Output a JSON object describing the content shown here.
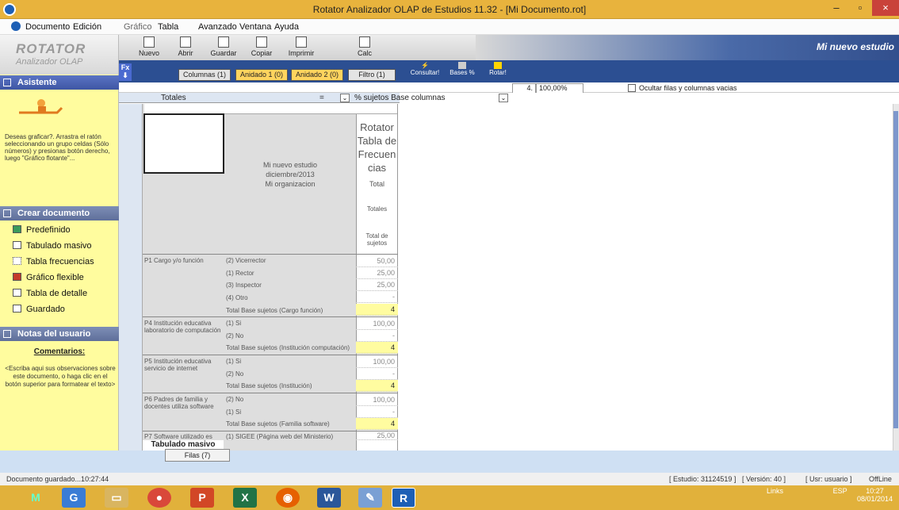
{
  "window": {
    "title": "Rotator Analizador OLAP de Estudios 11.32 - [Mi Documento.rot]",
    "min": "–",
    "max": "▫",
    "close": "×"
  },
  "menu": [
    "Documento",
    "Edición",
    "Gráfico",
    "Tabla",
    "Avanzado",
    "Ventana",
    "Ayuda"
  ],
  "logo": {
    "name": "ROTATOR",
    "sub": "Analizador OLAP"
  },
  "toolbar": [
    "Nuevo",
    "Abrir",
    "Guardar",
    "Copiar",
    "Imprimir",
    "Calc"
  ],
  "brand": "Mi nuevo estudio",
  "dims": {
    "columnas": "Columnas (1)",
    "anidado1": "Anidado 1 (0)",
    "anidado2": "Anidado 2 (0)",
    "filtro": "Filtro (1)"
  },
  "actions": [
    "Consultar!",
    "Bases %",
    "Rotar!"
  ],
  "options": {
    "decimals": "4.",
    "pct": "100,00%",
    "hide_empty": "Ocultar filas y columnas vacias"
  },
  "header": {
    "rows_label": "Totales",
    "eq": "=",
    "cols_label": "% sujetos Base columnas"
  },
  "sidebar": {
    "asistente": "Asistente",
    "help": "Deseas graficar?. Arrastra el ratón seleccionando un grupo celdas (Sólo números) y presionas botón derecho, luego \"Gráfico flotante\"...",
    "crear": "Crear documento",
    "items": [
      "Predefinido",
      "Tabulado masivo",
      "Tabla frecuencias",
      "Gráfico flexible",
      "Tabla de detalle",
      "Guardado"
    ],
    "notas": "Notas del usuario",
    "comentarios": "Comentarios:",
    "note": "<Escriba aqui sus observaciones sobre este documento, o haga clic en el botón superior para formatear el texto>"
  },
  "table": {
    "study": [
      "Mi nuevo estudio",
      "diciembre/2013",
      "Mi organizacion"
    ],
    "title": [
      "Rotator",
      "Tabla de",
      "Frecuen",
      "cias"
    ],
    "col_total": "Total",
    "col_totales": "Totales",
    "col_sujetos": "Total de sujetos",
    "rows": [
      {
        "q": "P1 Cargo y/o función",
        "labels": [
          "(2) Vicerrector",
          "(1) Rector",
          "(3) Inspector",
          "(4) Otro",
          "Total Base sujetos (Cargo función)"
        ],
        "values": [
          "50,00",
          "25,00",
          "25,00",
          "-",
          "4"
        ]
      },
      {
        "q": "P4 Institución educativa laboratorio de computación",
        "labels": [
          "(1) Si",
          "(2) No",
          "Total Base sujetos (Institución computación)"
        ],
        "values": [
          "100,00",
          "-",
          "4"
        ]
      },
      {
        "q": "P5 Institución educativa servicio de internet",
        "labels": [
          "(1) Si",
          "(2) No",
          "Total Base sujetos (Institución)"
        ],
        "values": [
          "100,00",
          "-",
          "4"
        ]
      },
      {
        "q": "P6 Padres de familia y docentes utiliza software",
        "labels": [
          "(2) No",
          "(1) Si",
          "Total Base sujetos (Familia software)"
        ],
        "values": [
          "100,00",
          "-",
          "4"
        ]
      },
      {
        "q": "P7 Software utilizado es",
        "labels": [
          "(1) SIGEE (Página web del Ministerio)"
        ],
        "values": [
          "25,00"
        ]
      }
    ]
  },
  "sheet": {
    "tab": "Filas (7)",
    "floating": "Tabulado masivo"
  },
  "status": {
    "left": "Documento guardado...10:27:44",
    "study": "[ Estudio: 31124519 ]",
    "version": "[ Versión: 40 ]",
    "user": "[ Usr: usuario ]",
    "mode": "OffLine"
  },
  "taskbar": {
    "links": "Links",
    "lang": "ESP",
    "time": "10:27",
    "date": "08/01/2014"
  }
}
